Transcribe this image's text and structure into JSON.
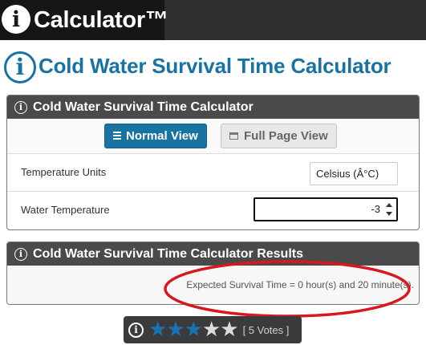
{
  "header": {
    "brand_icon": "info-icon",
    "brand_title": "Calculator™"
  },
  "page": {
    "icon": "info-icon",
    "title": "Cold Water Survival Time Calculator"
  },
  "calculator_panel": {
    "icon": "info-icon",
    "title": "Cold Water Survival Time Calculator",
    "normal_view_label": "Normal View",
    "full_page_view_label": "Full Page View",
    "temperature_units_label": "Temperature Units",
    "temperature_units_value": "Celsius (Â°C)",
    "water_temperature_label": "Water Temperature",
    "water_temperature_value": "-3"
  },
  "results_panel": {
    "icon": "info-icon",
    "title": "Cold Water Survival Time Calculator Results",
    "result_text": "Expected Survival Time = 0 hour(s) and 20 minute(s)."
  },
  "annotation": {
    "shape": "ellipse",
    "color": "#d7191f"
  },
  "rating": {
    "icon": "info-icon",
    "filled_stars": 3,
    "total_stars": 5,
    "votes_text": "[ 5 Votes ]"
  },
  "colors": {
    "accent": "#1873a3",
    "panel_header": "#4a4a4a",
    "banner": "#2f2f2f"
  }
}
